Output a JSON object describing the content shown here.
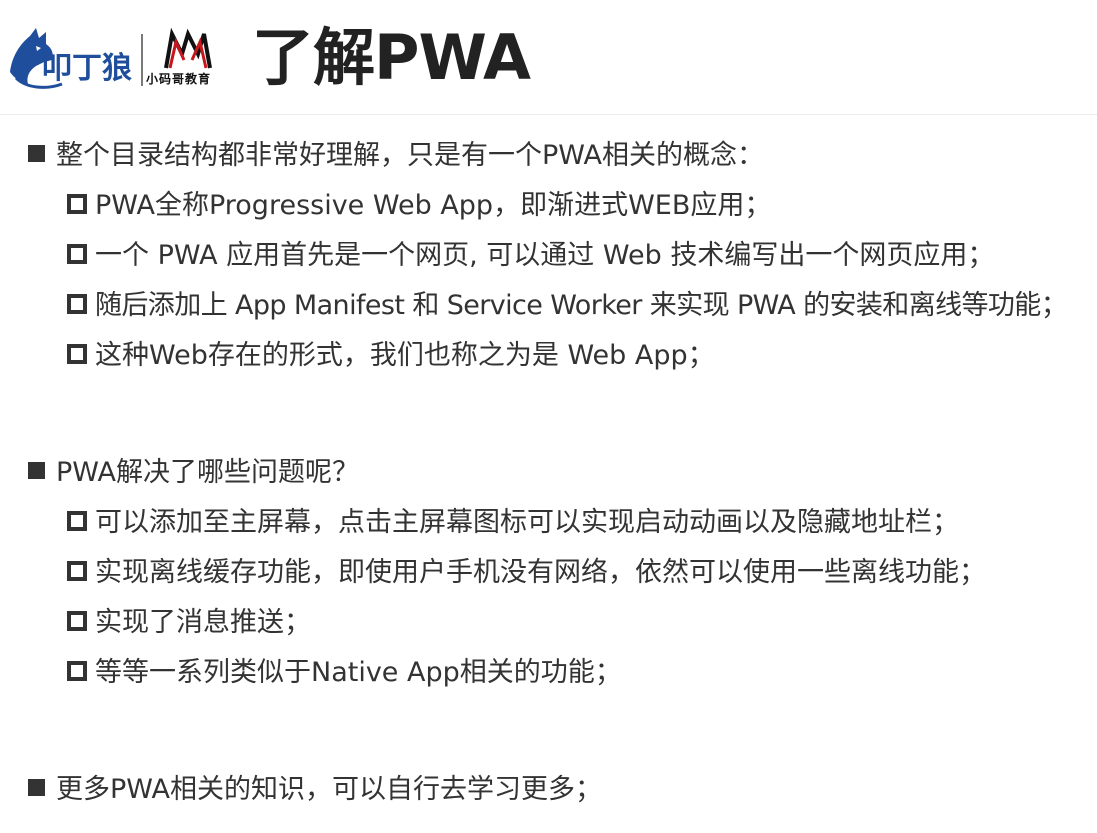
{
  "header": {
    "logo_brand": "叩丁狼",
    "logo_partner": "小码哥教育",
    "title": "了解PWA"
  },
  "sections": [
    {
      "heading": "整个目录结构都非常好理解，只是有一个PWA相关的概念：",
      "items": [
        "PWA全称Progressive Web App，即渐进式WEB应用；",
        "一个 PWA 应用首先是一个网页, 可以通过 Web 技术编写出一个网页应用；",
        "随后添加上 App Manifest 和 Service Worker 来实现 PWA 的安装和离线等功能；",
        "这种Web存在的形式，我们也称之为是 Web App；"
      ]
    },
    {
      "heading": "PWA解决了哪些问题呢？",
      "items": [
        "可以添加至主屏幕，点击主屏幕图标可以实现启动动画以及隐藏地址栏；",
        "实现离线缓存功能，即使用户手机没有网络，依然可以使用一些离线功能；",
        "实现了消息推送；",
        "等等一系列类似于Native App相关的功能；"
      ]
    },
    {
      "heading": "更多PWA相关的知识，可以自行去学习更多；",
      "items": []
    }
  ],
  "colors": {
    "text": "#333333",
    "title": "#222222",
    "logo_blue": "#1f4e9c",
    "logo_red": "#c8161d"
  }
}
